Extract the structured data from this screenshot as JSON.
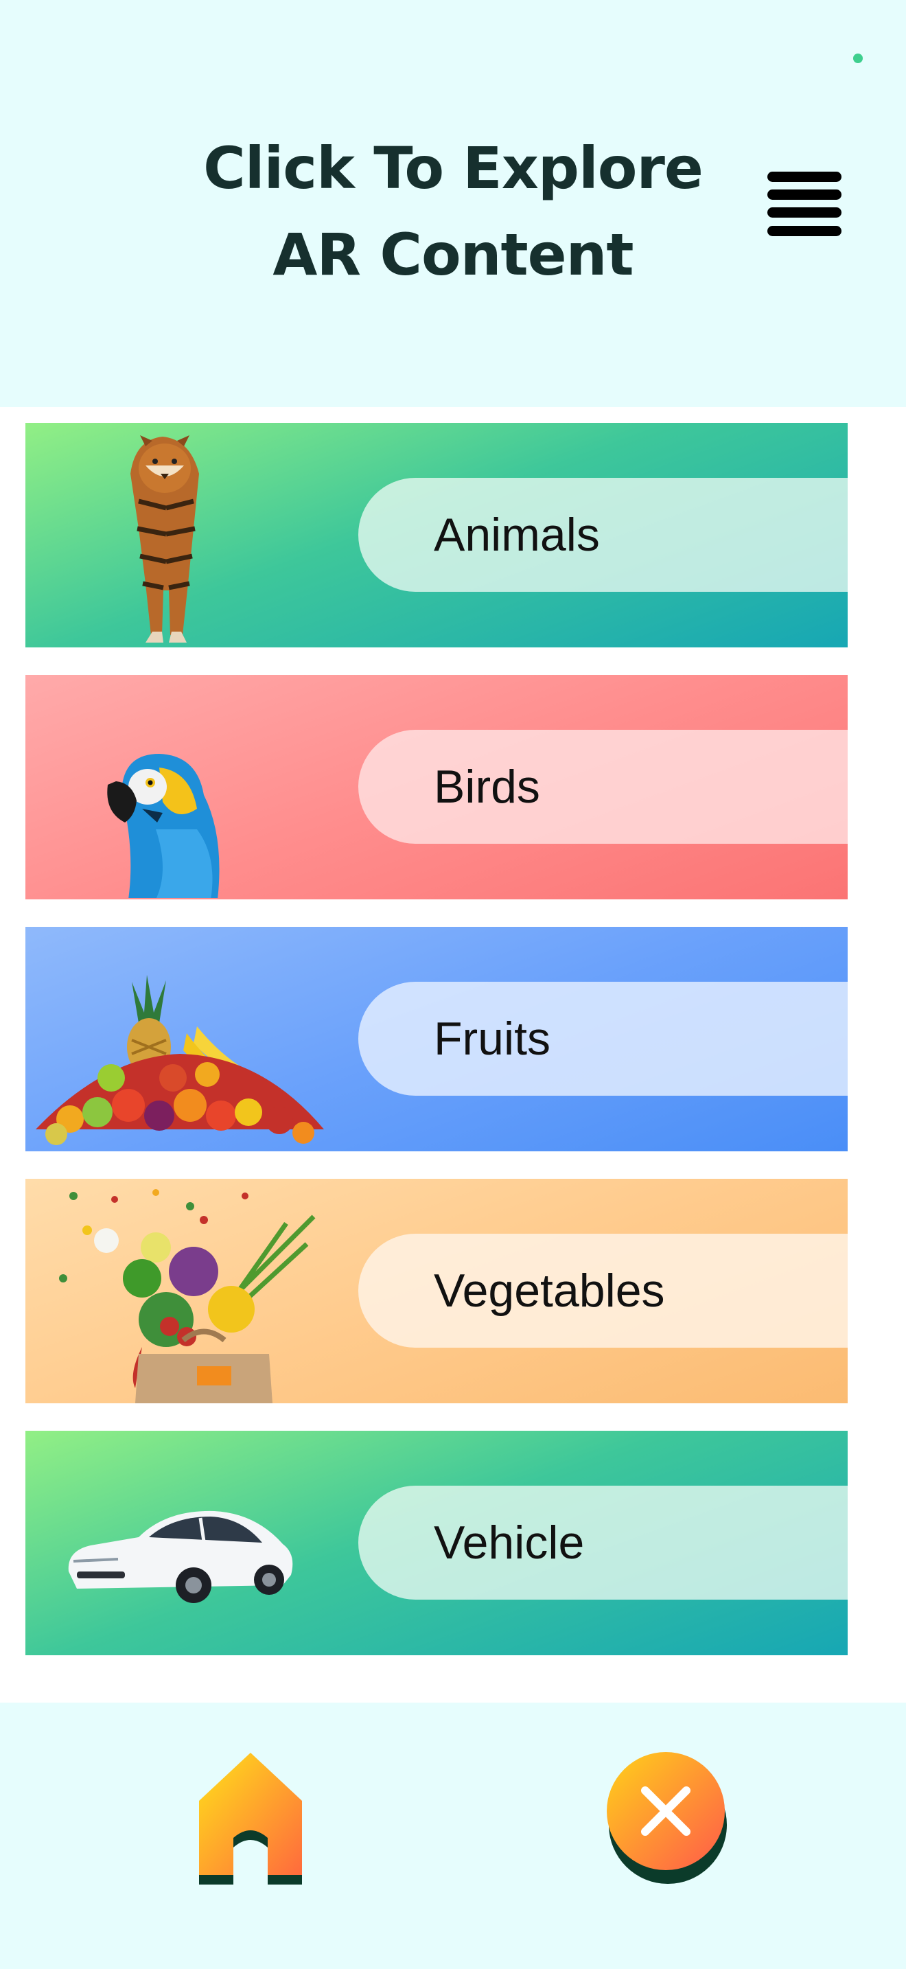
{
  "header": {
    "title_line1": "Click To Explore",
    "title_line2": "AR Content",
    "menu_icon": "hamburger-menu-icon"
  },
  "categories": [
    {
      "label": "Animals",
      "image": "tiger-image",
      "accent": "#17a7b4"
    },
    {
      "label": "Birds",
      "image": "parrot-image",
      "accent": "#fb7474"
    },
    {
      "label": "Fruits",
      "image": "fruit-pile-image",
      "accent": "#4a8ef7"
    },
    {
      "label": "Vegetables",
      "image": "vegetable-bag-image",
      "accent": "#fbbb72"
    },
    {
      "label": "Vehicle",
      "image": "car-image",
      "accent": "#17a7b4"
    }
  ],
  "footer": {
    "home_icon": "home-icon",
    "close_icon": "close-icon"
  },
  "colors": {
    "header_background": "#e6fdfd",
    "title_text": "#16302e",
    "status_dot": "#3ecf8e"
  }
}
